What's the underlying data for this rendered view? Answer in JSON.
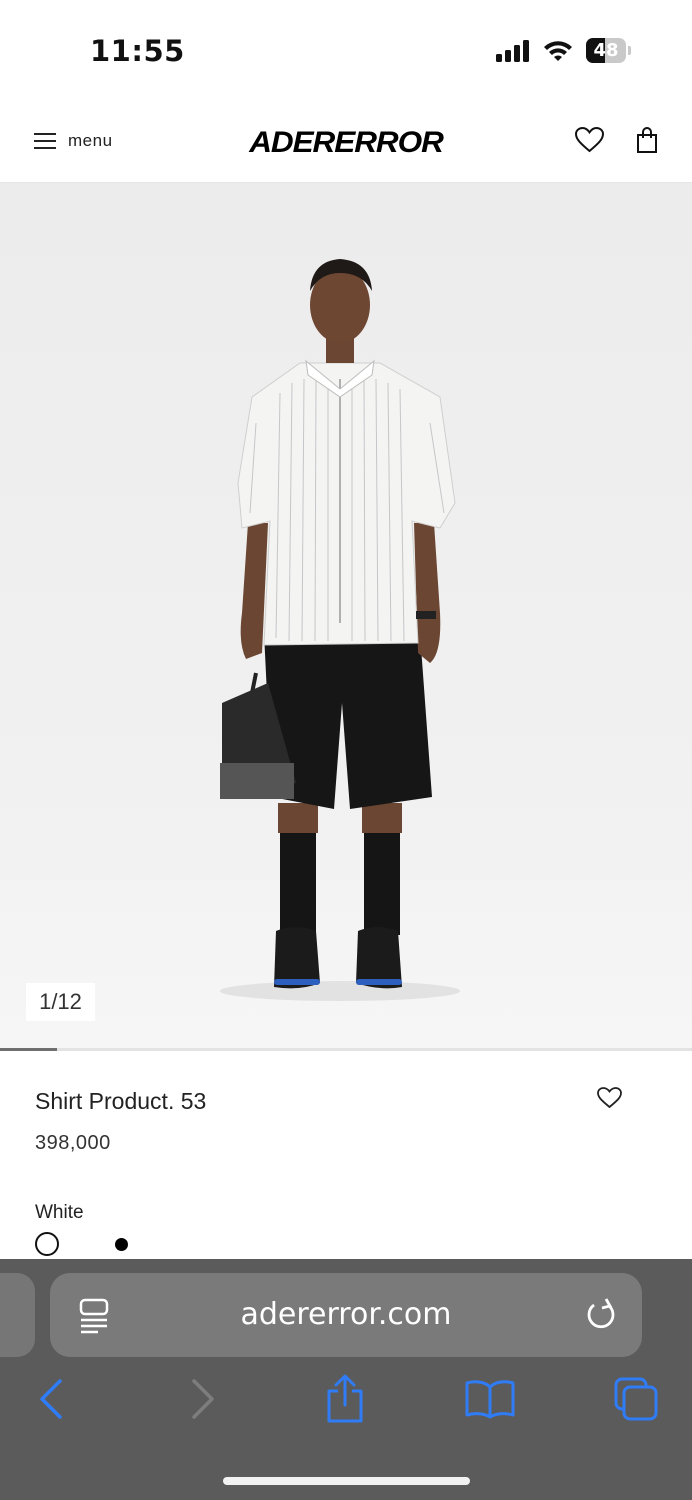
{
  "status_bar": {
    "time": "11:55",
    "battery": "48",
    "battery_level": 0.48
  },
  "header": {
    "menu_label": "menu",
    "logo": "ADERERROR"
  },
  "product": {
    "image_counter": "1/12",
    "gallery_progress": 0.083,
    "name": "Shirt Product. 53",
    "price": "398,000",
    "color_label": "White",
    "swatches": [
      "white",
      "black"
    ]
  },
  "browser": {
    "url": "adererror.com"
  },
  "colors": {
    "ios_blue": "#2f7cf6",
    "toolbar_bg": "#5b5b5b"
  }
}
